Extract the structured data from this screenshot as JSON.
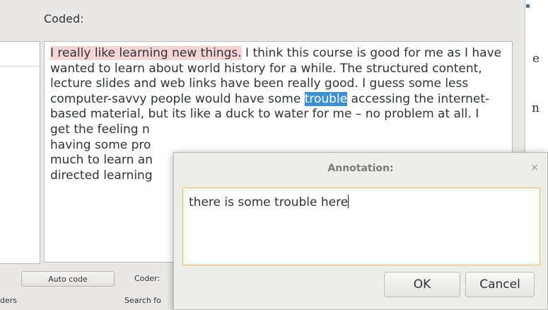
{
  "back_window": {
    "right_letters": [
      "e",
      "n"
    ]
  },
  "coded_window": {
    "title": "Coded:",
    "text": {
      "coded_part": "I really like learning new things.",
      "before_selection": " I think this course is good for me as I have wanted to learn about world history for a while. The structured content, lecture slides and web links have been really good. I guess some less computer-savvy people would have some ",
      "selected": "trouble",
      "after_selection": " accessing the internet-based material, but its like a duck to water for me – no problem at all. I",
      "line8": "get the feeling n",
      "line9": "having some pro",
      "line10": "much to learn an",
      "line11": "directed learning"
    },
    "bottom": {
      "auto_code_label": "Auto code",
      "coder_label": "Coder:",
      "folders_label": "ders",
      "search_label": "Search fo"
    }
  },
  "annotation_dialog": {
    "title": "Annotation:",
    "close_glyph": "×",
    "input_value": "there is some trouble here",
    "ok_label": "OK",
    "cancel_label": "Cancel"
  }
}
